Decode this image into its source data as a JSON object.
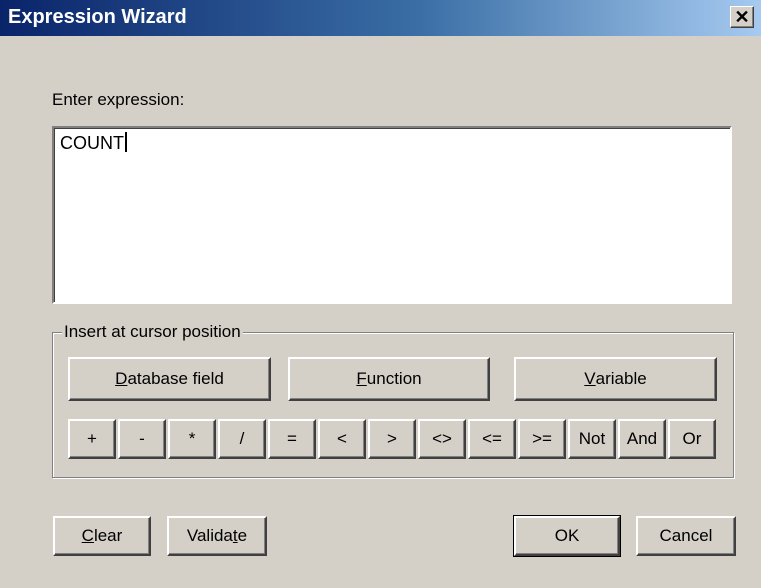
{
  "window": {
    "title": "Expression Wizard",
    "close_label": "✕"
  },
  "expression": {
    "label": "Enter expression:",
    "value": "COUNT"
  },
  "insert_group": {
    "legend": "Insert at cursor position",
    "database_field": {
      "mnemonic": "D",
      "rest": "atabase field"
    },
    "function": {
      "mnemonic": "F",
      "rest": "unction"
    },
    "variable": {
      "mnemonic": "V",
      "rest": "ariable"
    },
    "operators": [
      "+",
      "-",
      "*",
      "/",
      "=",
      "<",
      ">",
      "<>",
      "<=",
      ">=",
      "Not",
      "And",
      "Or"
    ]
  },
  "footer": {
    "clear": {
      "mnemonic": "C",
      "rest": "lear"
    },
    "validate": {
      "pre": "Valida",
      "mnemonic": "t",
      "post": "e"
    },
    "ok": "OK",
    "cancel": "Cancel"
  }
}
